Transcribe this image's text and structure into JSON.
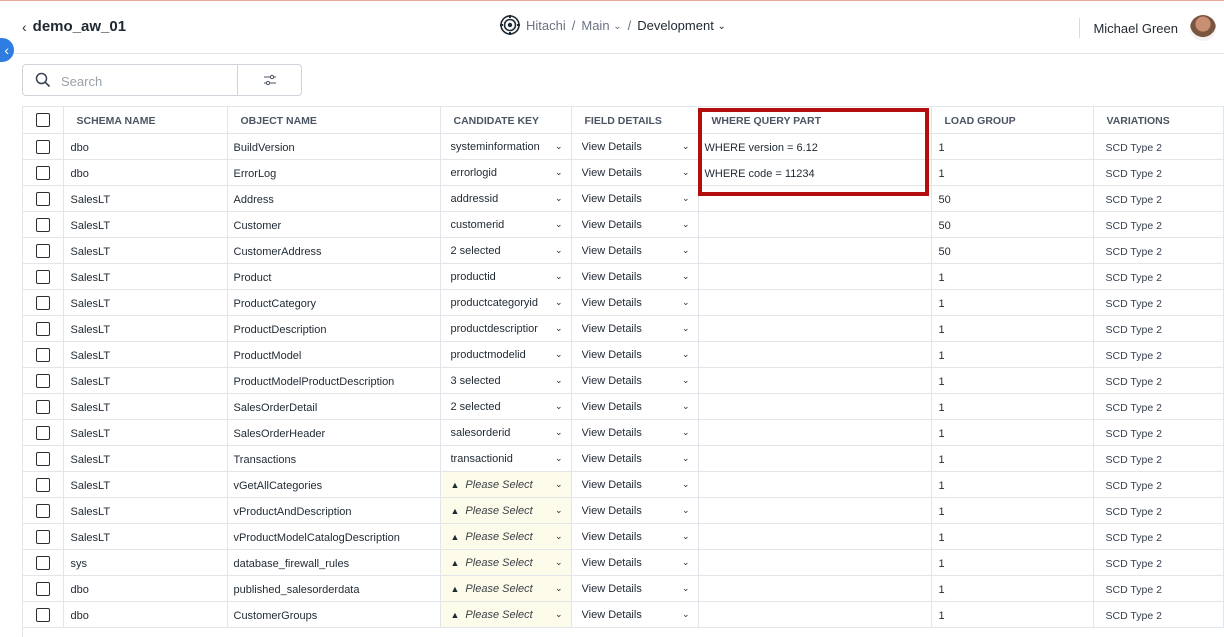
{
  "header": {
    "back_label": "demo_aw_01",
    "org": "Hitachi",
    "separator": "/",
    "workspace": "Main",
    "environment": "Development",
    "user_name": "Michael Green"
  },
  "search": {
    "placeholder": "Search"
  },
  "table": {
    "columns": [
      "SCHEMA NAME",
      "OBJECT NAME",
      "CANDIDATE KEY",
      "FIELD DETAILS",
      "WHERE QUERY PART",
      "LOAD GROUP",
      "VARIATIONS"
    ],
    "rows": [
      {
        "schema": "dbo",
        "object": "BuildVersion",
        "key": "systeminformation",
        "key_state": "set",
        "details": "View Details",
        "where": "WHERE version = 6.12",
        "load": "1",
        "variation": "SCD Type 2"
      },
      {
        "schema": "dbo",
        "object": "ErrorLog",
        "key": "errorlogid",
        "key_state": "set",
        "details": "View Details",
        "where": "WHERE code = 11234",
        "load": "1",
        "variation": "SCD Type 2"
      },
      {
        "schema": "SalesLT",
        "object": "Address",
        "key": "addressid",
        "key_state": "set",
        "details": "View Details",
        "where": "",
        "load": "50",
        "variation": "SCD Type 2"
      },
      {
        "schema": "SalesLT",
        "object": "Customer",
        "key": "customerid",
        "key_state": "set",
        "details": "View Details",
        "where": "",
        "load": "50",
        "variation": "SCD Type 2"
      },
      {
        "schema": "SalesLT",
        "object": "CustomerAddress",
        "key": "2 selected",
        "key_state": "set",
        "details": "View Details",
        "where": "",
        "load": "50",
        "variation": "SCD Type 2"
      },
      {
        "schema": "SalesLT",
        "object": "Product",
        "key": "productid",
        "key_state": "set",
        "details": "View Details",
        "where": "",
        "load": "1",
        "variation": "SCD Type 2"
      },
      {
        "schema": "SalesLT",
        "object": "ProductCategory",
        "key": "productcategoryid",
        "key_state": "set",
        "details": "View Details",
        "where": "",
        "load": "1",
        "variation": "SCD Type 2"
      },
      {
        "schema": "SalesLT",
        "object": "ProductDescription",
        "key": "productdescriptior",
        "key_state": "set",
        "details": "View Details",
        "where": "",
        "load": "1",
        "variation": "SCD Type 2"
      },
      {
        "schema": "SalesLT",
        "object": "ProductModel",
        "key": "productmodelid",
        "key_state": "set",
        "details": "View Details",
        "where": "",
        "load": "1",
        "variation": "SCD Type 2"
      },
      {
        "schema": "SalesLT",
        "object": "ProductModelProductDescription",
        "key": "3 selected",
        "key_state": "set",
        "details": "View Details",
        "where": "",
        "load": "1",
        "variation": "SCD Type 2"
      },
      {
        "schema": "SalesLT",
        "object": "SalesOrderDetail",
        "key": "2 selected",
        "key_state": "set",
        "details": "View Details",
        "where": "",
        "load": "1",
        "variation": "SCD Type 2"
      },
      {
        "schema": "SalesLT",
        "object": "SalesOrderHeader",
        "key": "salesorderid",
        "key_state": "set",
        "details": "View Details",
        "where": "",
        "load": "1",
        "variation": "SCD Type 2"
      },
      {
        "schema": "SalesLT",
        "object": "Transactions",
        "key": "transactionid",
        "key_state": "set",
        "details": "View Details",
        "where": "",
        "load": "1",
        "variation": "SCD Type 2"
      },
      {
        "schema": "SalesLT",
        "object": "vGetAllCategories",
        "key": "Please Select",
        "key_state": "empty",
        "details": "View Details",
        "where": "",
        "load": "1",
        "variation": "SCD Type 2"
      },
      {
        "schema": "SalesLT",
        "object": "vProductAndDescription",
        "key": "Please Select",
        "key_state": "empty",
        "details": "View Details",
        "where": "",
        "load": "1",
        "variation": "SCD Type 2"
      },
      {
        "schema": "SalesLT",
        "object": "vProductModelCatalogDescription",
        "key": "Please Select",
        "key_state": "empty",
        "details": "View Details",
        "where": "",
        "load": "1",
        "variation": "SCD Type 2"
      },
      {
        "schema": "sys",
        "object": "database_firewall_rules",
        "key": "Please Select",
        "key_state": "empty",
        "details": "View Details",
        "where": "",
        "load": "1",
        "variation": "SCD Type 2"
      },
      {
        "schema": "dbo",
        "object": "published_salesorderdata",
        "key": "Please Select",
        "key_state": "empty",
        "details": "View Details",
        "where": "",
        "load": "1",
        "variation": "SCD Type 2"
      },
      {
        "schema": "dbo",
        "object": "CustomerGroups",
        "key": "Please Select",
        "key_state": "empty",
        "details": "View Details",
        "where": "",
        "load": "1",
        "variation": "SCD Type 2"
      }
    ]
  },
  "colors": {
    "accent": "#2f7de1",
    "highlight": "#b30d0d",
    "warning_bg": "#fdfbe9"
  }
}
